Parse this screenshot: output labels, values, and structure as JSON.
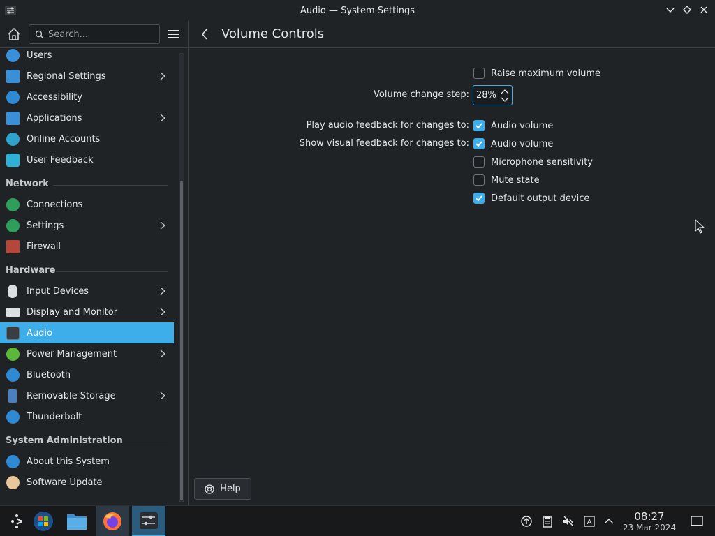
{
  "window": {
    "title": "Audio — System Settings"
  },
  "sidebar": {
    "search_placeholder": "Search...",
    "items": [
      {
        "label": "Users",
        "icon": "users-icon"
      },
      {
        "label": "Regional Settings",
        "icon": "flag-icon"
      },
      {
        "label": "Accessibility",
        "icon": "accessibility-icon"
      },
      {
        "label": "Applications",
        "icon": "applications-icon"
      },
      {
        "label": "Online Accounts",
        "icon": "globe-icon"
      },
      {
        "label": "User Feedback",
        "icon": "chat-icon"
      }
    ],
    "sections": {
      "network": "Network",
      "hardware": "Hardware",
      "sysadmin": "System Administration"
    },
    "network_items": [
      {
        "label": "Connections",
        "icon": "globe-icon"
      },
      {
        "label": "Settings",
        "icon": "globe-icon"
      },
      {
        "label": "Firewall",
        "icon": "firewall-icon"
      }
    ],
    "hardware_items": [
      {
        "label": "Input Devices",
        "icon": "mouse-icon"
      },
      {
        "label": "Display and Monitor",
        "icon": "monitor-icon"
      },
      {
        "label": "Audio",
        "icon": "speaker-icon"
      },
      {
        "label": "Power Management",
        "icon": "power-icon"
      },
      {
        "label": "Bluetooth",
        "icon": "bluetooth-icon"
      },
      {
        "label": "Removable Storage",
        "icon": "usb-icon"
      },
      {
        "label": "Thunderbolt",
        "icon": "thunderbolt-icon"
      }
    ],
    "sysadmin_items": [
      {
        "label": "About this System",
        "icon": "info-icon"
      },
      {
        "label": "Software Update",
        "icon": "update-icon"
      }
    ]
  },
  "main": {
    "page_title": "Volume Controls",
    "raise_max_label": "Raise maximum volume",
    "raise_max_checked": false,
    "step_label": "Volume change step:",
    "step_value": "28%",
    "audio_feedback_label": "Play audio feedback for changes to:",
    "audio_feedback_option": "Audio volume",
    "audio_feedback_checked": true,
    "visual_feedback_label": "Show visual feedback for changes to:",
    "visual_options": [
      {
        "label": "Audio volume",
        "checked": true
      },
      {
        "label": "Microphone sensitivity",
        "checked": false
      },
      {
        "label": "Mute state",
        "checked": false
      },
      {
        "label": "Default output device",
        "checked": true
      }
    ],
    "help_label": "Help"
  },
  "taskbar": {
    "time": "08:27",
    "date": "23 Mar 2024"
  },
  "colors": {
    "accent": "#3daee9",
    "background": "#202326",
    "text": "#e3e5e7"
  }
}
